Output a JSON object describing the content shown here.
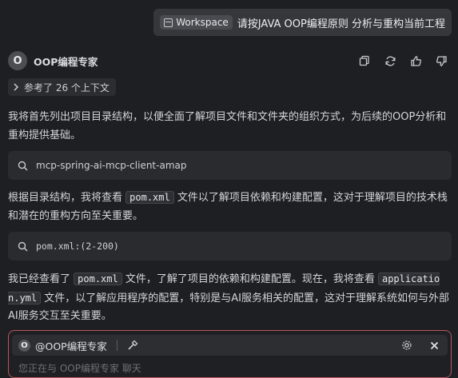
{
  "user_message": {
    "chip_label": "Workspace",
    "text": "请按JAVA OOP编程原则 分析与重构当前工程"
  },
  "agent": {
    "avatar_letter": "O",
    "name": "OOP编程专家"
  },
  "context_ref": {
    "label": "参考了 26 个上下文"
  },
  "paragraphs": {
    "p1": "我将首先列出项目目录结构，以便全面了解项目文件和文件夹的组织方式，为后续的OOP分析和重构提供基础。",
    "p2_before": "根据目录结构，我将查看 ",
    "p2_code": "pom.xml",
    "p2_after": " 文件以了解项目依赖和构建配置，这对于理解项目的技术栈和潜在的重构方向至关重要。",
    "p3_before": "我已经查看了 ",
    "p3_code1": "pom.xml",
    "p3_mid": " 文件，了解了项目的依赖和构建配置。现在，我将查看 ",
    "p3_code2": "application.yml",
    "p3_after": " 文件，以了解应用程序的配置，特别是与AI服务相关的配置，这对于理解系统如何与外部AI服务交互至关重要。"
  },
  "tool_calls": [
    {
      "icon": "search-icon",
      "text": "mcp-spring-ai-mcp-client-amap"
    },
    {
      "icon": "search-icon",
      "text": "pom.xml:(2-200)"
    }
  ],
  "input": {
    "agent_avatar_letter": "O",
    "agent_mention": "@OOP编程专家",
    "placeholder": "您正在与 OOP编程专家 聊天"
  },
  "colors": {
    "background": "#1e1f22",
    "accent_border": "#b5585c"
  }
}
